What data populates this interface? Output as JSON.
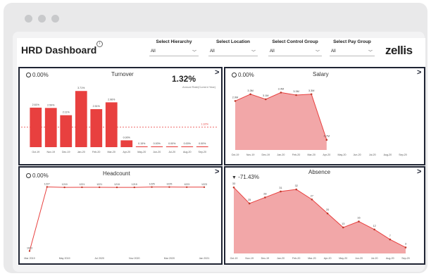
{
  "dashboard": {
    "title": "HRD Dashboard",
    "info_icon": "info-icon",
    "logo": "zellis",
    "filters": [
      {
        "label": "Select Hierarchy",
        "value": "All"
      },
      {
        "label": "Select Location",
        "value": "All"
      },
      {
        "label": "Select Control Group",
        "value": "All"
      },
      {
        "label": "Select Pay Group",
        "value": "All"
      }
    ]
  },
  "turnover": {
    "title": "Turnover",
    "change": "0.00%",
    "kpi": "1.32%",
    "kpi_sub": "Annual Rate(Current Year)",
    "ref_label": "1.32%",
    "chart_data": {
      "type": "bar",
      "categories": [
        "Oct-19",
        "Nov-19",
        "Dec-19",
        "Jan-20",
        "Feb-20",
        "Mar-20",
        "Apr-20",
        "May-20",
        "Jun-20",
        "Jul-20",
        "Aug-20",
        "Sep-20"
      ],
      "values": [
        2.61,
        2.59,
        2.11,
        3.71,
        2.51,
        2.96,
        0.45,
        0.05,
        0.05,
        0.05,
        0.05,
        0.05
      ],
      "labels": [
        "2.61%",
        "2.59%",
        "2.11%",
        "3.71%",
        "2.51%",
        "2.96%",
        "0.00%",
        "0.15%",
        "0.00%",
        "0.00%",
        "0.00%",
        "0.00%"
      ],
      "reference": 1.32
    }
  },
  "salary": {
    "title": "Salary",
    "change": "0.00%",
    "chart_data": {
      "type": "area",
      "categories": [
        "Oct-19",
        "Nov-19",
        "Dec-19",
        "Jan-20",
        "Feb-20",
        "Mar-20",
        "Apr-20",
        "May-20",
        "Jun-20",
        "Jul-20",
        "Aug-20",
        "Sep-20"
      ],
      "values": [
        2.9,
        3.3,
        3.0,
        3.4,
        3.25,
        3.3,
        0.6,
        null,
        null,
        null,
        null,
        null
      ],
      "labels": [
        "2.9M",
        "3.3M",
        "3.1M",
        "3.4M",
        "3.3M",
        "3.3M",
        "0.7M",
        "",
        "",
        "",
        "",
        ""
      ]
    }
  },
  "headcount": {
    "title": "Headcount",
    "change": "0.00%",
    "chart_data": {
      "type": "line",
      "categories": [
        "Mar 2019",
        "May 2019",
        "Jul 2020",
        "Nov 2020",
        "Mar 2020",
        "Jan 2021"
      ],
      "x": [
        0,
        1,
        2,
        3,
        4,
        5,
        6,
        7,
        8,
        9,
        10
      ],
      "values": [
        20,
        1227,
        1219,
        1221,
        1221,
        1219,
        1219,
        1225,
        1225,
        1223,
        1223
      ],
      "labels": [
        "1013",
        "1227",
        "1219",
        "1221",
        "1221",
        "1219",
        "1219",
        "1225",
        "1225",
        "1223",
        "1223"
      ]
    }
  },
  "absence": {
    "title": "Absence",
    "change": "-71.43%",
    "chart_data": {
      "type": "area",
      "categories": [
        "Oct-19",
        "Nov-19",
        "Dec-19",
        "Jan-20",
        "Feb-20",
        "Mar-20",
        "Apr-20",
        "May-20",
        "Jun-20",
        "Jul-20",
        "Aug-20",
        "Sep-20"
      ],
      "values": [
        33,
        25,
        28,
        31,
        32,
        27,
        20,
        13,
        16,
        12,
        7,
        3
      ],
      "labels": [
        "33",
        "25",
        "28",
        "31",
        "32",
        "27",
        "20",
        "13",
        "16",
        "12",
        "7",
        "3"
      ]
    }
  }
}
